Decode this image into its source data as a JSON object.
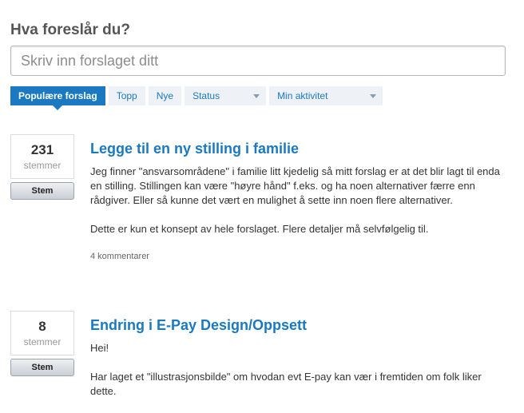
{
  "header": {
    "title": "Hva foreslår du?",
    "search_placeholder": "Skriv inn forslaget ditt"
  },
  "filters": {
    "tabs": [
      "Populære forslag",
      "Topp",
      "Nye"
    ],
    "status_label": "Status",
    "activity_label": "Min aktivitet"
  },
  "ideas": [
    {
      "votes": "231",
      "votes_label": "stemmer",
      "vote_button": "Stem",
      "title": "Legge til en ny stilling i familie",
      "paragraphs": [
        "Jeg finner \"ansvarsområdene\" i familie litt kjedelig så mitt forslag er at det blir lagt til enda en stilling. Stillingen kan være \"høyre hånd\" f.eks. og ha noen alternativer færre enn rådgiver. Eller så kunne det vært en mulighet å sette inn noen flere alternativer.",
        "Dette er kun et konsept av hele forslaget. Flere detaljer må selvfølgelig til."
      ],
      "comments": "4 kommentarer"
    },
    {
      "votes": "8",
      "votes_label": "stemmer",
      "vote_button": "Stem",
      "title": "Endring i E-Pay Design/Oppsett",
      "paragraphs": [
        "Hei!",
        "Har laget et \"illustrasjonsbilde\" om hvodan evt E-pay kan vær i fremtiden om folk liker dette."
      ]
    }
  ],
  "colors": {
    "accent": "#1a79c0",
    "tab_bg": "#eef2f7"
  }
}
